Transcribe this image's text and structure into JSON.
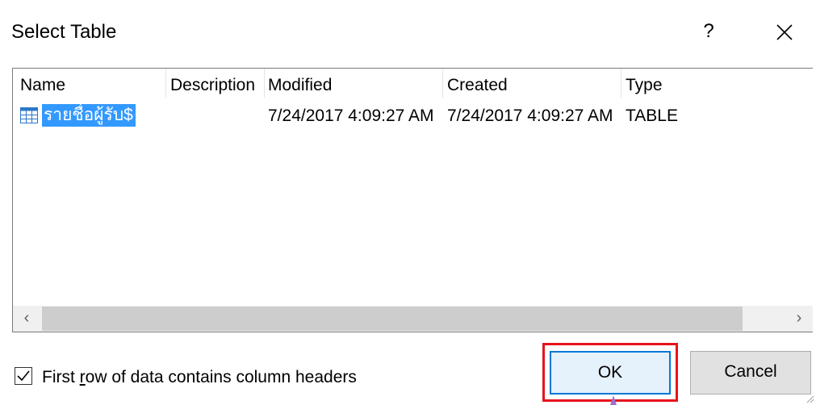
{
  "dialog": {
    "title": "Select Table",
    "help_label": "?",
    "close_icon": "close-icon"
  },
  "table": {
    "columns": [
      "Name",
      "Description",
      "Modified",
      "Created",
      "Type"
    ],
    "rows": [
      {
        "icon": "table-icon",
        "name": "รายชื่อผู้รับ$",
        "description": "",
        "modified": "7/24/2017 4:09:27 AM",
        "created": "7/24/2017 4:09:27 AM",
        "type": "TABLE"
      }
    ]
  },
  "scrollbar": {
    "left_arrow": "‹",
    "right_arrow": "›"
  },
  "options": {
    "first_row_headers": {
      "label_pre": "First ",
      "label_accel": "r",
      "label_post": "ow of data contains column headers",
      "checked": true
    }
  },
  "buttons": {
    "ok_label": "OK",
    "cancel_label": "Cancel"
  },
  "colors": {
    "selection": "#3399ff",
    "highlight_frame": "#e8121c",
    "default_button_border": "#0078d7"
  }
}
